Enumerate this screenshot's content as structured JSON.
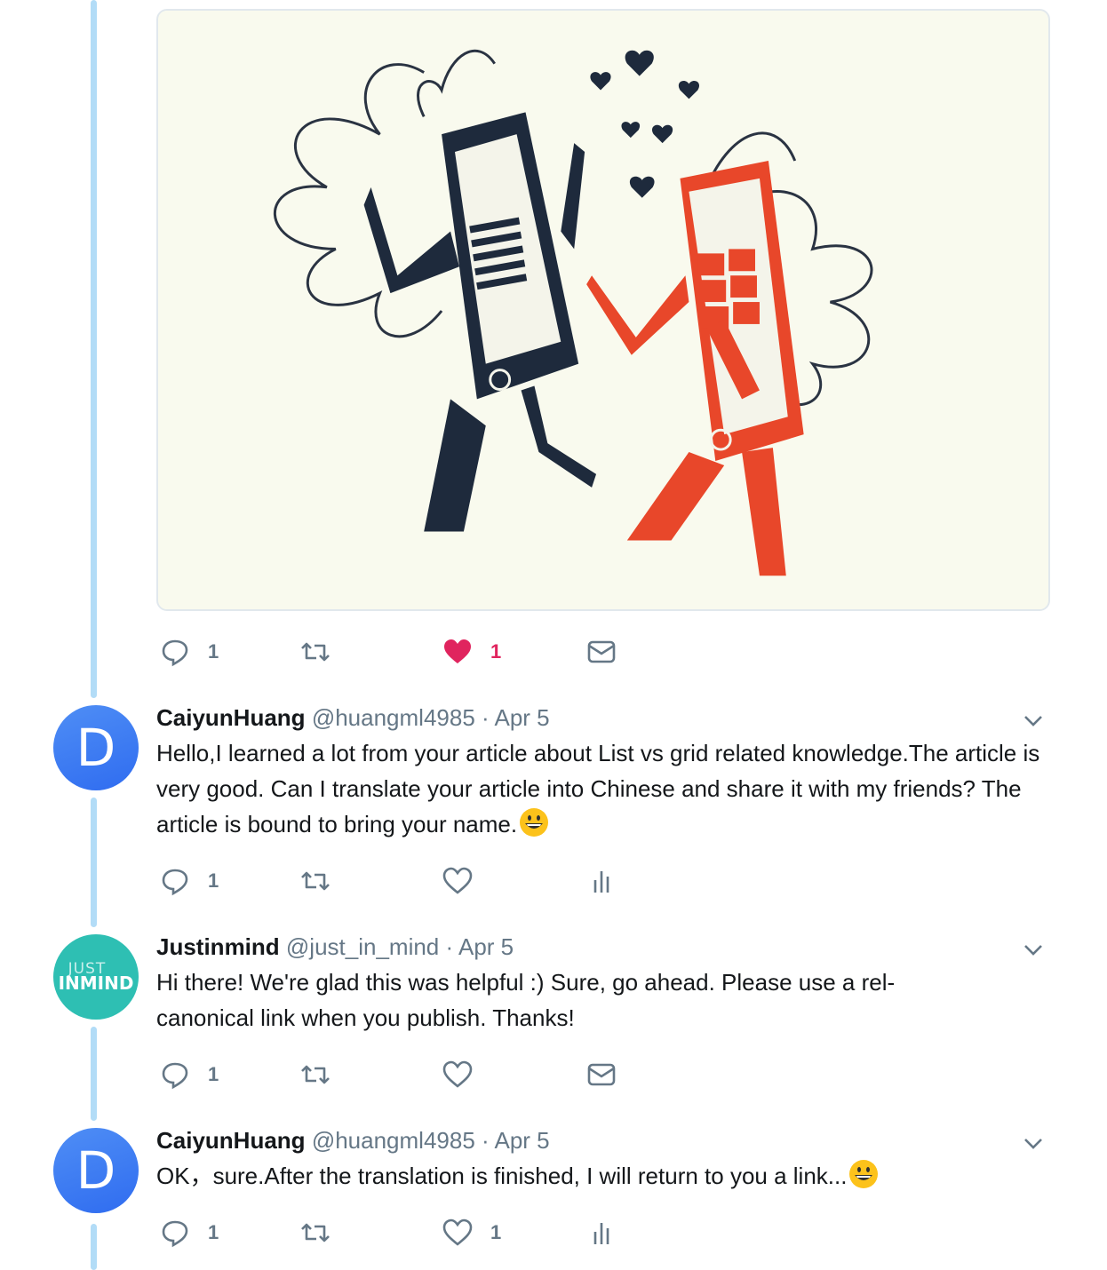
{
  "media": {
    "alt_icon": "phones-in-love-illustration"
  },
  "first_actions": {
    "reply_count": "1",
    "retweet_count": "",
    "like_count": "1",
    "icons": [
      "reply-icon",
      "retweet-icon",
      "heart-filled-icon",
      "message-icon"
    ]
  },
  "tweets": [
    {
      "avatar_letter": "D",
      "name": "CaiyunHuang",
      "handle": "@huangml4985",
      "sep": "·",
      "date": "Apr 5",
      "text": "Hello,I learned a lot from your article about List vs grid related knowledge.The article is very good. Can I translate your article into Chinese and share it with my friends? The article is bound to bring your name.",
      "emoji": "grinning-face",
      "reply_count": "1",
      "like_count": ""
    },
    {
      "avatar_line1": "JUST",
      "avatar_line2": "INMIND",
      "name": "Justinmind",
      "handle": "@just_in_mind",
      "sep": "·",
      "date": "Apr 5",
      "text": "Hi there! We're glad this was helpful :) Sure, go ahead. Please use a rel-canonical link when you publish. Thanks!",
      "reply_count": "1",
      "like_count": ""
    },
    {
      "avatar_letter": "D",
      "name": "CaiyunHuang",
      "handle": "@huangml4985",
      "sep": "·",
      "date": "Apr 5",
      "text": "OK，sure.After the translation is finished, I will return to you a link...",
      "emoji": "grinning-face",
      "reply_count": "1",
      "like_count": "1"
    }
  ],
  "colors": {
    "thread_line": "#b2dcf7",
    "like_red": "#e0245e",
    "avatar_blue": "#3b7cf2",
    "avatar_teal": "#2ebfb3",
    "muted": "#657786"
  }
}
